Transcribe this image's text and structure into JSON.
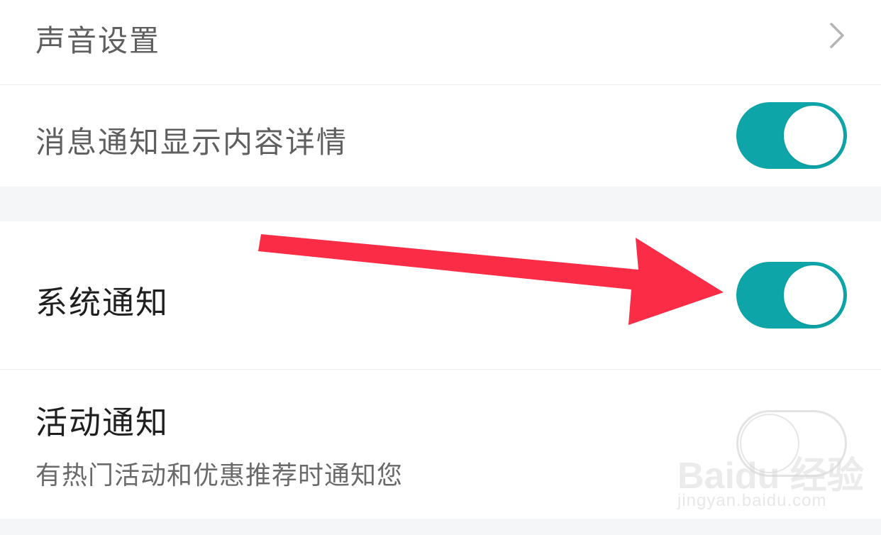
{
  "settings": {
    "sound": {
      "label": "声音设置",
      "icon": "chevron-right-icon"
    },
    "message_detail": {
      "label": "消息通知显示内容详情",
      "enabled": true
    },
    "system_notify": {
      "label": "系统通知",
      "enabled": true
    },
    "activity_notify": {
      "label": "活动通知",
      "description": "有热门活动和优惠推荐时通知您",
      "enabled": false
    }
  },
  "annotation": {
    "icon": "red-arrow-icon",
    "color": "#fb2c45"
  },
  "watermark": {
    "main": "Baidu 经验",
    "url": "jingyan.baidu.com"
  },
  "colors": {
    "toggle_on": "#0ea5a9",
    "toggle_off": "#ffffff",
    "background": "#f5f6f8"
  }
}
